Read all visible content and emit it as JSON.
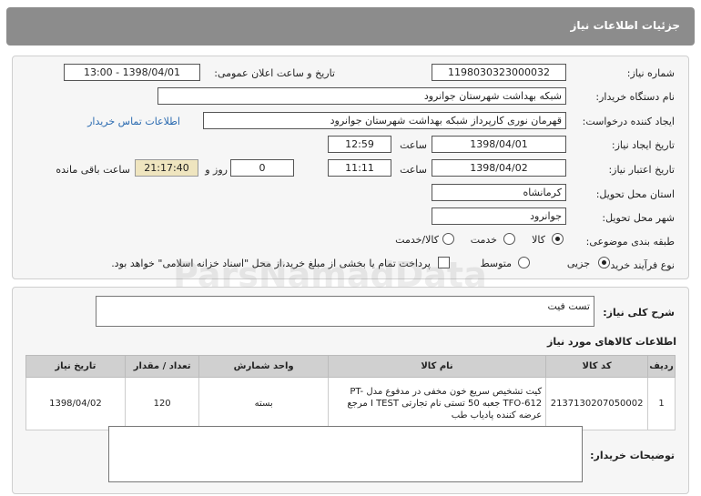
{
  "header": {
    "title": "جزئیات اطلاعات نیاز"
  },
  "form": {
    "need_number_label": "شماره نیاز:",
    "need_number": "1198030323000032",
    "announce_label": "تاریخ و ساعت اعلان عمومی:",
    "announce_value": "1398/04/01 - 13:00",
    "buyer_label": "نام دستگاه خریدار:",
    "buyer": "شبکه بهداشت شهرستان جوانرود",
    "creator_label": "ایجاد کننده درخواست:",
    "creator": "قهرمان نوری کارپرداز شبکه بهداشت شهرستان جوانرود",
    "contact_link": "اطلاعات تماس خریدار",
    "created_date_label": "تاریخ ایجاد نیاز:",
    "created_date": "1398/04/01",
    "time_label": "ساعت",
    "created_time": "12:59",
    "validity_label": "تاریخ اعتبار نیاز:",
    "validity_date": "1398/04/02",
    "validity_time": "11:11",
    "days_label": "روز و",
    "days": "0",
    "remaining": "21:17:40",
    "remaining_label": "ساعت باقی مانده",
    "province_label": "استان محل تحویل:",
    "province": "کرمانشاه",
    "city_label": "شهر محل تحویل:",
    "city": "جوانرود",
    "category_label": "طبقه بندی موضوعی:",
    "category_options": [
      "کالا",
      "خدمت",
      "کالا/خدمت"
    ],
    "purchase_type_label": "نوع فرآیند خرید :",
    "purchase_options": [
      "جزیی",
      "متوسط"
    ],
    "payment_note": "پرداخت تمام یا بخشی از مبلغ خرید،از محل \"اسناد خزانه اسلامی\" خواهد بود."
  },
  "summary": {
    "label": "شرح کلی نیاز:",
    "value": "تست فیت"
  },
  "items": {
    "title": "اطلاعات کالاهای مورد نیاز",
    "columns": [
      "ردیف",
      "کد کالا",
      "نام کالا",
      "واحد شمارش",
      "تعداد / مقدار",
      "تاریخ نیاز"
    ],
    "rows": [
      {
        "row": "1",
        "code": "2137130207050002",
        "name": "کیت تشخیص سریع خون مخفی در مدفوع مدل PT-TFO-612 جعبه 50 تستی نام تجارتی I TEST مرجع عرضه کننده پادیاب طب",
        "unit": "بسته",
        "qty": "120",
        "date": "1398/04/02"
      }
    ]
  },
  "buyer_notes": {
    "label": "توضیحات خریدار:",
    "value": ""
  },
  "watermark": "ParsNamadData"
}
